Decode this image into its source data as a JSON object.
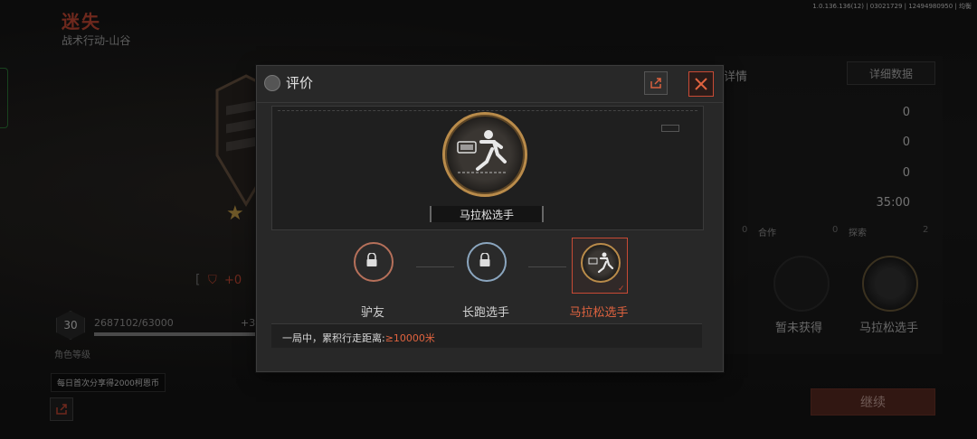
{
  "build_info": "1.0.136.136(12) | 03021729 | 12494980950 | 均衡",
  "background": {
    "title": "迷失",
    "subtitle": "战术行动-山谷",
    "plus_value": "+0",
    "level": {
      "number": "30",
      "xp_text": "2687102/63000",
      "xp_gain": "+3",
      "progress": 0.95,
      "label": "角色等级"
    },
    "share_tip": "每日首次分享得2000柯恩币",
    "right_panel": {
      "tab_label": "详情",
      "detail_button": "详细数据",
      "values": [
        "0",
        "0",
        "0",
        "35:00"
      ],
      "columns": [
        {
          "head": "合作",
          "num": "0"
        },
        {
          "head": "探索",
          "num": "2"
        }
      ],
      "medal_labels": [
        "得",
        "暂未获得",
        "马拉松选手"
      ],
      "continue_button": "继续"
    }
  },
  "modal": {
    "title": "评价",
    "featured": {
      "name": "马拉松选手",
      "icon": "runner-stopwatch-icon"
    },
    "medals": [
      {
        "label": "驴友",
        "tier": "bronze",
        "locked": true
      },
      {
        "label": "长跑选手",
        "tier": "silver",
        "locked": true
      },
      {
        "label": "马拉松选手",
        "tier": "gold",
        "locked": false,
        "selected": true
      }
    ],
    "description": {
      "prefix": "一局中，累积行走距离:",
      "value": "≥10000米"
    }
  },
  "colors": {
    "accent": "#e0633f",
    "gold": "#b98b4a",
    "bronze": "#b6705a",
    "silver": "#8ba6bf"
  }
}
